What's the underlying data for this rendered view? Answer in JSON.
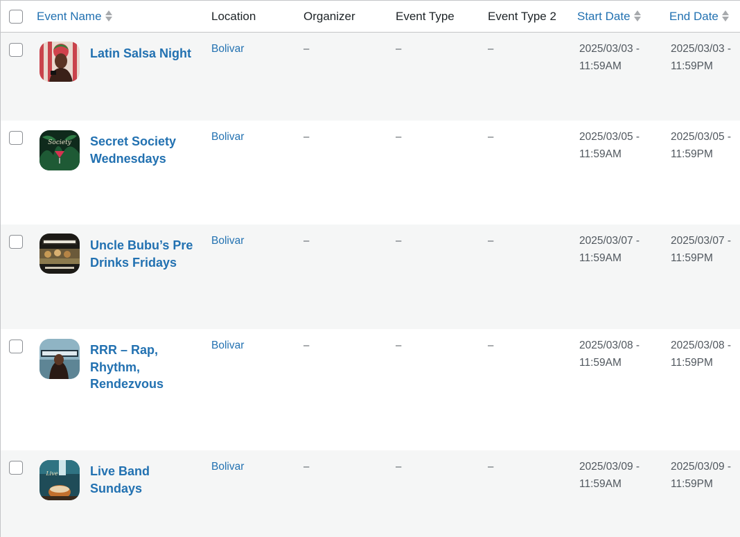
{
  "headers": {
    "event_name": "Event Name",
    "location": "Location",
    "organizer": "Organizer",
    "event_type": "Event Type",
    "event_type_2": "Event Type 2",
    "start_date": "Start Date",
    "end_date": "End Date"
  },
  "colors": {
    "link": "#2271b1",
    "row_alt": "#f5f6f6",
    "border": "#c3c4c7"
  },
  "rows": [
    {
      "name": "Latin Salsa Night",
      "location": "Bolivar",
      "organizer": "–",
      "event_type": "–",
      "event_type_2": "–",
      "start_date": "2025/03/03 - 11:59AM",
      "end_date": "2025/03/03 - 11:59PM",
      "thumb_icon": "latin-salsa-poster-thumbnail"
    },
    {
      "name": "Secret Society Wednesdays",
      "location": "Bolivar",
      "organizer": "–",
      "event_type": "–",
      "event_type_2": "–",
      "start_date": "2025/03/05 - 11:59AM",
      "end_date": "2025/03/05 - 11:59PM",
      "thumb_icon": "secret-society-poster-thumbnail"
    },
    {
      "name": "Uncle Bubu’s Pre Drinks Fridays",
      "location": "Bolivar",
      "organizer": "–",
      "event_type": "–",
      "event_type_2": "–",
      "start_date": "2025/03/07 - 11:59AM",
      "end_date": "2025/03/07 - 11:59PM",
      "thumb_icon": "pre-drinks-poster-thumbnail"
    },
    {
      "name": "RRR – Rap, Rhythm, Rendezvous",
      "location": "Bolivar",
      "organizer": "–",
      "event_type": "–",
      "event_type_2": "–",
      "start_date": "2025/03/08 - 11:59AM",
      "end_date": "2025/03/08 - 11:59PM",
      "thumb_icon": "rendezvous-poster-thumbnail"
    },
    {
      "name": "Live Band Sundays",
      "location": "Bolivar",
      "organizer": "–",
      "event_type": "–",
      "event_type_2": "–",
      "start_date": "2025/03/09 - 11:59AM",
      "end_date": "2025/03/09 - 11:59PM",
      "thumb_icon": "live-band-poster-thumbnail"
    }
  ]
}
